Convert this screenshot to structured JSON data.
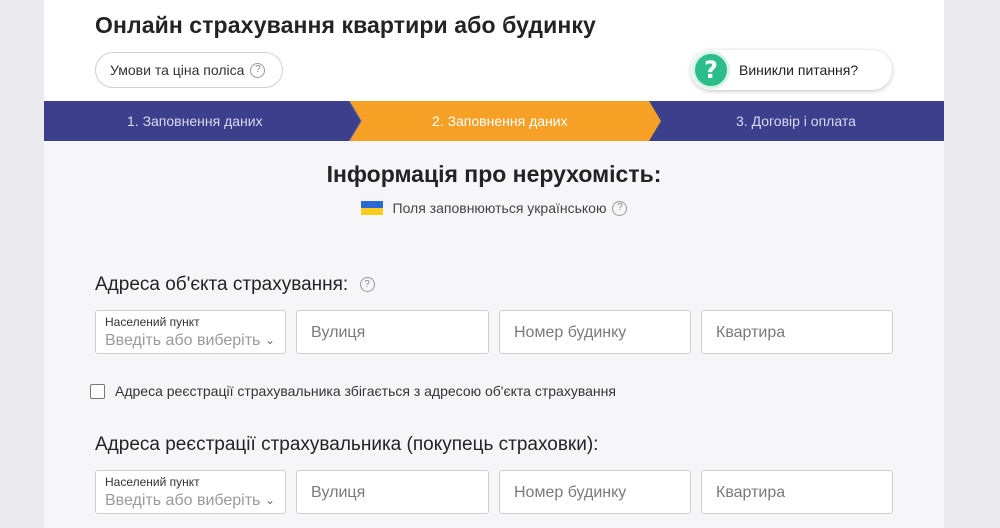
{
  "header": {
    "title": "Онлайн страхування квартири або будинку",
    "terms_button": "Умови та ціна поліса",
    "help_button": "Виникли питання?"
  },
  "steps": [
    {
      "label": "1. Заповнення даних",
      "state": "done"
    },
    {
      "label": "2. Заповнення даних",
      "state": "active"
    },
    {
      "label": "3. Договір і оплата",
      "state": "pending"
    }
  ],
  "colors": {
    "step_bg": "#3c408c",
    "step_active": "#f6a026",
    "help_green": "#2bbd8a"
  },
  "main": {
    "section_title": "Інформація про нерухомість:",
    "lang_note": "Поля заповнюються українською",
    "object_address": {
      "label": "Адреса об'єкта страхування:",
      "city_label": "Населений пункт",
      "city_placeholder": "Введіть або виберіть",
      "street_placeholder": "Вулиця",
      "house_placeholder": "Номер будинку",
      "apartment_placeholder": "Квартира"
    },
    "same_address_checkbox": "Адреса реєстрації страхувальника збігається з адресою об'єкта страхування",
    "insurer_address": {
      "label": "Адреса реєстрації страхувальника (покупець страховки):",
      "city_label": "Населений пункт",
      "city_placeholder": "Введіть або виберіть",
      "street_placeholder": "Вулиця",
      "house_placeholder": "Номер будинку",
      "apartment_placeholder": "Квартира"
    }
  }
}
